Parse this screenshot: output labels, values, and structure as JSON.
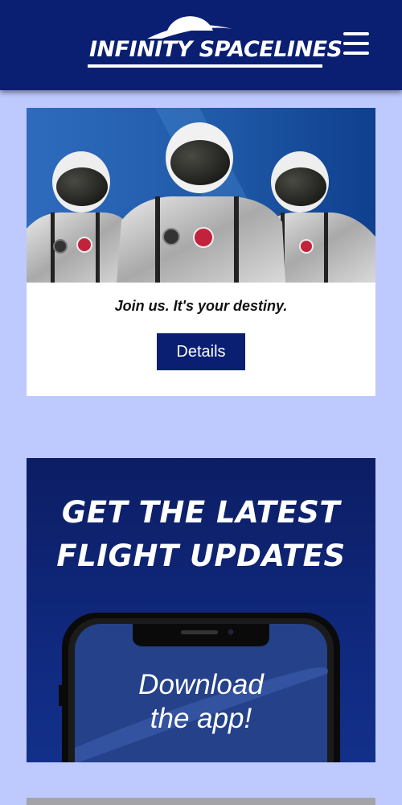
{
  "header": {
    "brand": "INFINITY SPACELINES",
    "menu_icon": "hamburger-menu-icon",
    "bg_color": "#0b1f72"
  },
  "join_card": {
    "tagline": "Join us. It's your destiny.",
    "button_label": "Details",
    "button_color": "#0b1f72"
  },
  "promo": {
    "headline_line1": "GET THE LATEST",
    "headline_line2": "FLIGHT UPDATES",
    "phone_line1": "Download",
    "phone_line2": "the app!"
  },
  "colors": {
    "page_bg": "#bec9fd",
    "brand_navy": "#0b1f72"
  }
}
